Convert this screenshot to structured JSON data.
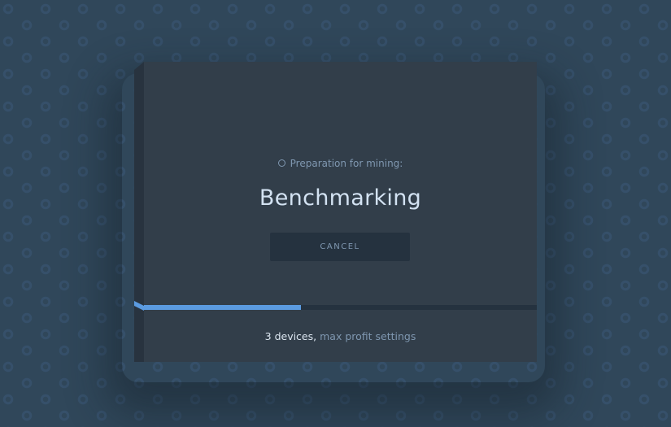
{
  "dialog": {
    "subtitle": "Preparation for mining:",
    "subtitle_icon": "clock-icon",
    "title": "Benchmarking",
    "cancel_label": "CANCEL",
    "progress_percent": 40,
    "devices_text": "3 devices,",
    "settings_link": "max profit settings"
  },
  "colors": {
    "accent": "#5b9be0",
    "card": "#323e4a",
    "background": "#30475a"
  }
}
